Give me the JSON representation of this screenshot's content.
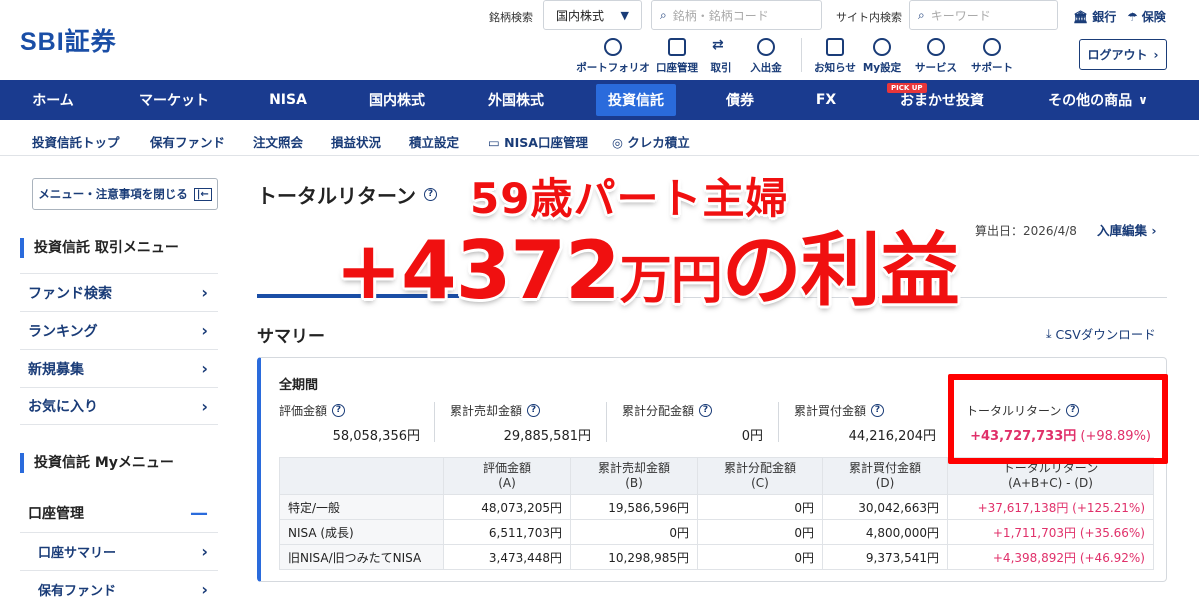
{
  "header": {
    "logo": "SBI証券",
    "brand_search_label": "銘柄検索",
    "brand_search_select": "国内株式",
    "brand_search_placeholder": "銘柄・銘柄コード",
    "site_search_label": "サイト内検索",
    "site_search_placeholder": "キーワード",
    "bank_link": "銀行",
    "insurance_link": "保険",
    "quick_icons": [
      {
        "label": "ポートフォリオ",
        "icon": "portfolio-icon"
      },
      {
        "label": "口座管理",
        "icon": "account-icon"
      },
      {
        "label": "取引",
        "icon": "trade-icon"
      },
      {
        "label": "入出金",
        "icon": "deposit-icon"
      },
      {
        "label": "お知らせ",
        "icon": "notice-icon"
      },
      {
        "label": "My設定",
        "icon": "my-settings-icon"
      },
      {
        "label": "サービス",
        "icon": "service-icon"
      },
      {
        "label": "サポート",
        "icon": "support-icon"
      }
    ],
    "logout": "ログアウト"
  },
  "main_nav": {
    "items": [
      "ホーム",
      "マーケット",
      "NISA",
      "国内株式",
      "外国株式",
      "投資信託",
      "債券",
      "FX",
      "おまかせ投資",
      "その他の商品"
    ],
    "active": "投資信託",
    "pickup_badge": "PICK UP"
  },
  "sub_nav": [
    "投資信託トップ",
    "保有ファンド",
    "注文照会",
    "損益状況",
    "積立設定",
    "NISA口座管理",
    "クレカ積立"
  ],
  "sidebar": {
    "close_button": "メニュー・注意事項を閉じる",
    "trade_menu_title": "投資信託 取引メニュー",
    "trade_menu": [
      "ファンド検索",
      "ランキング",
      "新規募集",
      "お気に入り"
    ],
    "my_menu_title": "投資信託 Myメニュー",
    "account_section": "口座管理",
    "account_items": [
      "口座サマリー",
      "保有ファンド"
    ]
  },
  "main": {
    "title": "トータルリターン",
    "calc_date": "算出日：2026/4/8",
    "edit_link": "入庫編集",
    "summary_title": "サマリー",
    "csv_link": "CSVダウンロード",
    "period": "全期間",
    "metrics": [
      {
        "label": "評価金額",
        "value": "58,058,356円"
      },
      {
        "label": "累計売却金額",
        "value": "29,885,581円"
      },
      {
        "label": "累計分配金額",
        "value": "0円"
      },
      {
        "label": "累計買付金額",
        "value": "44,216,204円"
      },
      {
        "label": "トータルリターン",
        "value": "+43,727,733円",
        "pct": "(+98.89%)"
      }
    ],
    "table": {
      "headers": [
        [
          "評価金額",
          "(A)"
        ],
        [
          "累計売却金額",
          "(B)"
        ],
        [
          "累計分配金額",
          "(C)"
        ],
        [
          "累計買付金額",
          "(D)"
        ],
        [
          "トータルリターン",
          "(A+B+C) - (D)"
        ]
      ],
      "rows": [
        {
          "label": "特定/一般",
          "a": "48,073,205円",
          "b": "19,586,596円",
          "c": "0円",
          "d": "30,042,663円",
          "tr": "+37,617,138円 (+125.21%)"
        },
        {
          "label": "NISA (成長)",
          "a": "6,511,703円",
          "b": "0円",
          "c": "0円",
          "d": "4,800,000円",
          "tr": "+1,711,703円 (+35.66%)"
        },
        {
          "label": "旧NISA/旧つみたてNISA",
          "a": "3,473,448円",
          "b": "10,298,985円",
          "c": "0円",
          "d": "9,373,541円",
          "tr": "+4,398,892円 (+46.92%)"
        }
      ]
    }
  },
  "overlay": {
    "headline1": "59歳パート主婦",
    "headline2_num": "+4372",
    "headline2_unit": "万円",
    "headline2_suffix": "の利益"
  },
  "colors": {
    "navy": "#1a3b8f",
    "accent": "#2a6bdc",
    "positive": "#e0306a",
    "overlay_red": "#f01010"
  }
}
